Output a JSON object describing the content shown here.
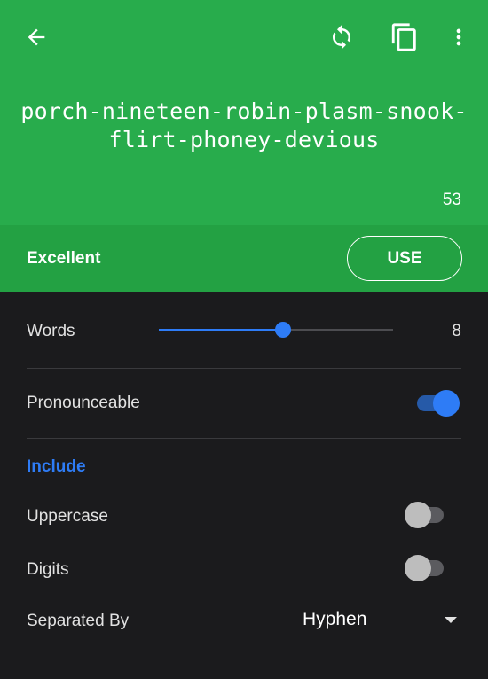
{
  "header": {
    "password": "porch-nineteen-robin-plasm-snook-flirt-phoney-devious",
    "length": "53",
    "icons": [
      "back-arrow-icon",
      "refresh-icon",
      "copy-icon",
      "more-vert-icon"
    ]
  },
  "strength": {
    "label": "Excellent",
    "use_label": "USE"
  },
  "settings": {
    "words": {
      "label": "Words",
      "value": "8",
      "fraction": 0.53
    },
    "pronounceable": {
      "label": "Pronounceable",
      "on": true
    },
    "include_title": "Include",
    "uppercase": {
      "label": "Uppercase",
      "on": false
    },
    "digits": {
      "label": "Digits",
      "on": false
    },
    "separator": {
      "label": "Separated By",
      "value": "Hyphen"
    }
  },
  "colors": {
    "header_bg": "#28ac4c",
    "strength_bg": "#23a143",
    "accent": "#2e7cf6",
    "background": "#1b1b1d"
  }
}
